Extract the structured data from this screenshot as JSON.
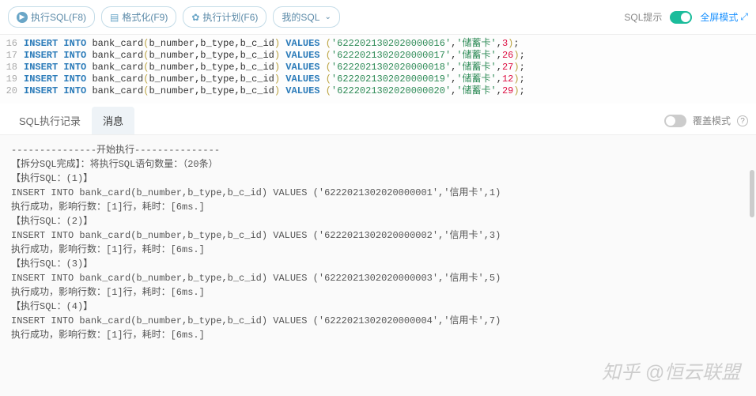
{
  "toolbar": {
    "execute": "执行SQL(F8)",
    "format": "格式化(F9)",
    "plan": "执行计划(F6)",
    "mysql": "我的SQL",
    "hint_label": "SQL提示",
    "fullscreen": "全屏模式"
  },
  "editor": {
    "lines": [
      {
        "ln": 16,
        "col": "bank_card",
        "args": "b_number,b_type,b_c_id",
        "s1": "'6222021302020000016'",
        "s2": "'储蓄卡'",
        "num": "3"
      },
      {
        "ln": 17,
        "col": "bank_card",
        "args": "b_number,b_type,b_c_id",
        "s1": "'6222021302020000017'",
        "s2": "'储蓄卡'",
        "num": "26"
      },
      {
        "ln": 18,
        "col": "bank_card",
        "args": "b_number,b_type,b_c_id",
        "s1": "'6222021302020000018'",
        "s2": "'储蓄卡'",
        "num": "27"
      },
      {
        "ln": 19,
        "col": "bank_card",
        "args": "b_number,b_type,b_c_id",
        "s1": "'6222021302020000019'",
        "s2": "'储蓄卡'",
        "num": "12"
      },
      {
        "ln": 20,
        "col": "bank_card",
        "args": "b_number,b_type,b_c_id",
        "s1": "'6222021302020000020'",
        "s2": "'储蓄卡'",
        "num": "29"
      }
    ],
    "kw_insert": "INSERT",
    "kw_into": "INTO",
    "kw_values": "VALUES"
  },
  "tabs": {
    "history": "SQL执行记录",
    "message": "消息",
    "overwrite": "覆盖模式"
  },
  "output": {
    "start_line": "---------------开始执行---------------",
    "split_line": "【拆分SQL完成】：将执行SQL语句数量：（20条）",
    "blocks": [
      {
        "hdr": "【执行SQL：(1)】",
        "sql": "INSERT INTO bank_card(b_number,b_type,b_c_id) VALUES ('6222021302020000001','信用卡',1)",
        "res": "执行成功，影响行数：[1]行，耗时：[6ms.]"
      },
      {
        "hdr": "【执行SQL：(2)】",
        "sql": "INSERT INTO bank_card(b_number,b_type,b_c_id) VALUES ('6222021302020000002','信用卡',3)",
        "res": "执行成功，影响行数：[1]行，耗时：[6ms.]"
      },
      {
        "hdr": "【执行SQL：(3)】",
        "sql": "INSERT INTO bank_card(b_number,b_type,b_c_id) VALUES ('6222021302020000003','信用卡',5)",
        "res": "执行成功，影响行数：[1]行，耗时：[6ms.]"
      },
      {
        "hdr": "【执行SQL：(4)】",
        "sql": "INSERT INTO bank_card(b_number,b_type,b_c_id) VALUES ('6222021302020000004','信用卡',7)",
        "res": "执行成功，影响行数：[1]行，耗时：[6ms.]"
      }
    ]
  },
  "watermark": "知乎 @恒云联盟"
}
